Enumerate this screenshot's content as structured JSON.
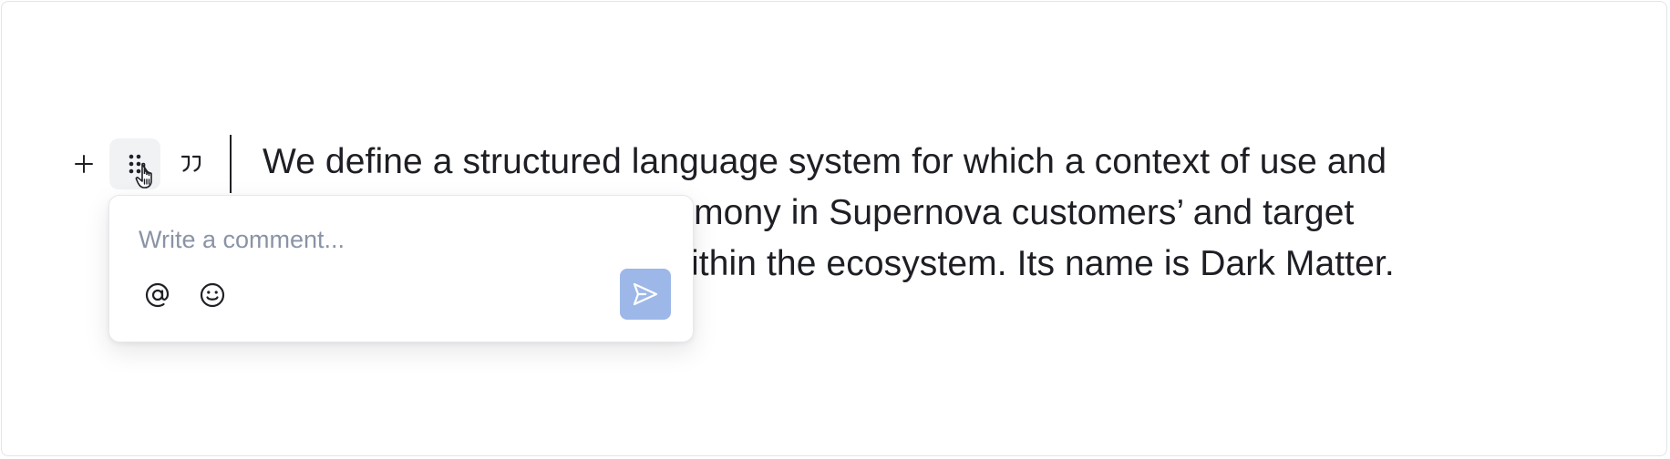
{
  "editor": {
    "paragraph_lines": [
      "We define a structured language system for which a context of use and",
      "rmony in Supernova customers’ and target",
      "ithin the ecosystem. Its name is Dark Matter."
    ]
  },
  "block_toolbar": {
    "icons": [
      "plus-icon",
      "drag-handle-icon",
      "quote-icon"
    ]
  },
  "comment_popover": {
    "placeholder": "Write a comment...",
    "value": "",
    "icons": [
      "at-mention-icon",
      "emoji-icon",
      "send-icon"
    ],
    "send_button_color": "#9db8e8"
  },
  "colors": {
    "text": "#1d1f24",
    "placeholder": "#8a93a6",
    "border": "#e2e4e8"
  }
}
